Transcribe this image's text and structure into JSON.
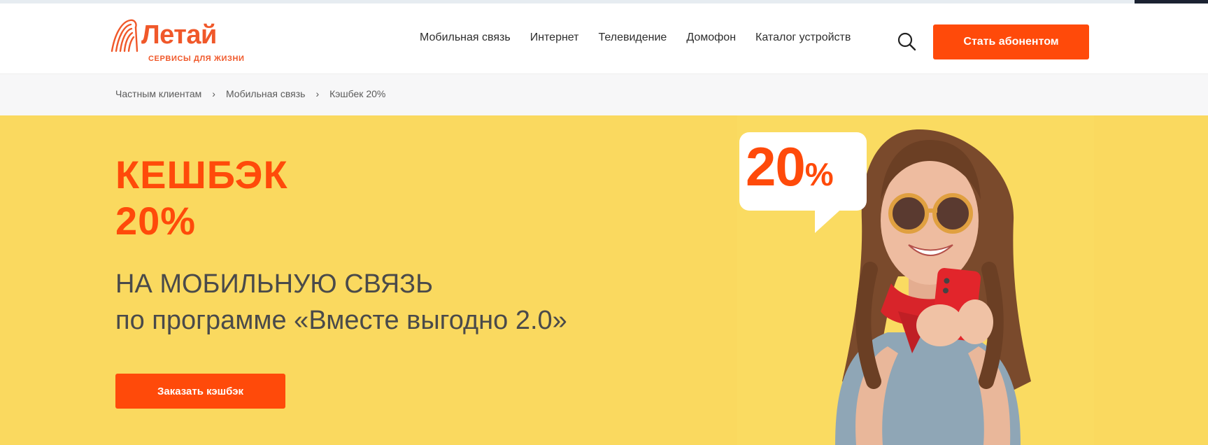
{
  "brand": {
    "name": "Летай",
    "tagline": "сервисы для жизни",
    "accent_color": "#ff4a0a",
    "logo_color": "#f0582a"
  },
  "nav": {
    "items": [
      {
        "label": "Мобильная связь"
      },
      {
        "label": "Интернет"
      },
      {
        "label": "Телевидение"
      },
      {
        "label": "Домофон"
      },
      {
        "label": "Каталог устройств"
      }
    ],
    "search_icon": "search-icon",
    "cta_label": "Стать абонентом"
  },
  "breadcrumbs": [
    {
      "label": "Частным клиентам"
    },
    {
      "label": "Мобильная связь"
    },
    {
      "label": "Кэшбек 20%"
    }
  ],
  "hero": {
    "title_line1": "КЕШБЭК",
    "title_line2": "20%",
    "subtitle_line1": "НА МОБИЛЬНУЮ СВЯЗЬ",
    "subtitle_line2": "по программе «Вместе выгодно 2.0»",
    "button_label": "Заказать кэшбэк",
    "background_color": "#fad95f",
    "bubble_number": "20",
    "bubble_percent": "%"
  }
}
